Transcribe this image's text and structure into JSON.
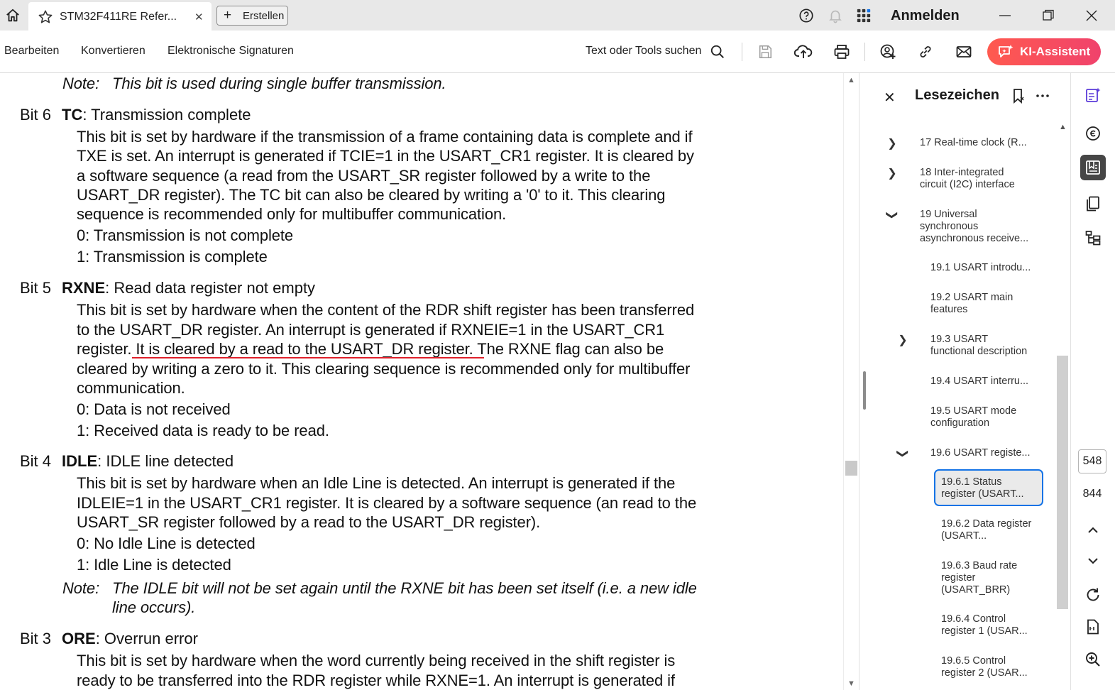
{
  "tabbar": {
    "tab_title": "STM32F411RE Refer...",
    "create_label": "Erstellen",
    "signin_label": "Anmelden",
    "icons": [
      "home-icon",
      "star-icon",
      "close-icon",
      "help-icon",
      "bell-icon",
      "apps-icon",
      "minimize-icon",
      "maximize-icon",
      "window-close-icon"
    ]
  },
  "toolbar": {
    "menus": [
      "Bearbeiten",
      "Konvertieren",
      "Elektronische Signaturen"
    ],
    "search_label": "Text oder Tools suchen",
    "ai_label": "KI-Assistent",
    "accent": "#f0426c"
  },
  "document": {
    "note_top": {
      "label": "Note:",
      "text": "This bit is used during single buffer transmission."
    },
    "bit6": {
      "no": "Bit 6",
      "name": "TC",
      "title": ": Transmission complete",
      "lines": [
        "This bit is set by hardware if the transmission of a frame containing data is complete and if",
        "TXE is set. An interrupt is generated if TCIE=1 in the USART_CR1 register. It is cleared by",
        "a software sequence (a read from the USART_SR register followed by a write to the",
        "USART_DR register). The TC bit can also be cleared by writing a '0' to it. This clearing",
        "sequence is recommended only for multibuffer communication."
      ],
      "values": [
        "0: Transmission is not complete",
        "1: Transmission is complete"
      ]
    },
    "bit5": {
      "no": "Bit 5",
      "name": "RXNE",
      "title": ": Read data register not empty",
      "lines": [
        "This bit is set by hardware when the content of the RDR shift register has been transferred",
        "to the USART_DR register. An interrupt is generated if RXNEIE=1 in the USART_CR1",
        "register. It is cleared by a read to the USART_DR register. The RXNE flag can also be",
        "cleared by writing a zero to it. This clearing sequence is recommended only for multibuffer",
        "communication."
      ],
      "values": [
        "0: Data is not received",
        "1: Received data is ready to be read."
      ]
    },
    "bit4": {
      "no": "Bit 4",
      "name": "IDLE",
      "title": ": IDLE line detected",
      "lines": [
        "This bit is set by hardware when an Idle Line is detected. An interrupt is generated if the",
        "IDLEIE=1 in the USART_CR1 register. It is cleared by a software sequence (an read to the",
        "USART_SR register followed by a read to the USART_DR register)."
      ],
      "values": [
        "0: No Idle Line is detected",
        "1: Idle Line is detected"
      ],
      "note_label": "Note:",
      "note_lines": [
        "The IDLE bit will not be set again until the RXNE bit has been set itself (i.e. a new idle",
        "line occurs)."
      ]
    },
    "bit3": {
      "no": "Bit 3",
      "name": "ORE",
      "title": ": Overrun error",
      "lines": [
        "This bit is set by hardware when the word currently being received in the shift register is",
        "ready to be transferred into the RDR register while RXNE=1. An interrupt is generated if"
      ]
    },
    "highlight_color": "#e0202a"
  },
  "bookmarks": {
    "title": "Lesezeichen",
    "items": [
      "17 Real-time clock (R...",
      "18 Inter-integrated circuit (I2C) interface",
      "19 Universal synchronous asynchronous receive...",
      "19.1 USART introdu...",
      "19.2 USART main features",
      "19.3 USART functional description",
      "19.4 USART interru...",
      "19.5 USART mode configuration",
      "19.6 USART registe...",
      "19.6.1 Status register (USART...",
      "19.6.2 Data register (USART...",
      "19.6.3 Baud rate register (USART_BRR)",
      "19.6.4 Control register 1 (USAR...",
      "19.6.5 Control register 2 (USAR..."
    ],
    "selected_index": 9,
    "selection_color": "#1473e6"
  },
  "rail": {
    "current_page": "548",
    "total_pages": "844"
  }
}
